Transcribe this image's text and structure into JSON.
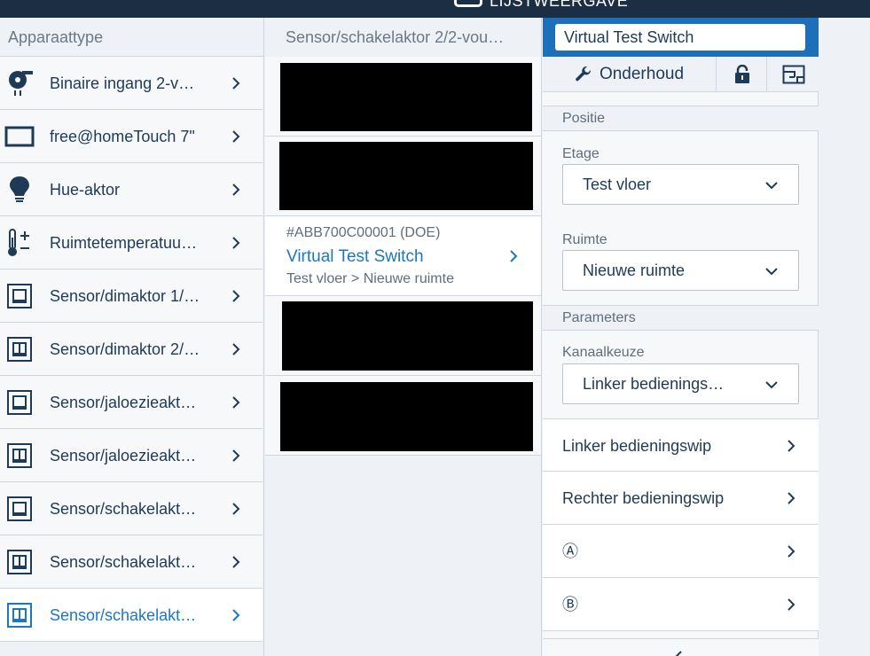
{
  "app": {
    "header_title": "LIJSTWEERGAVE"
  },
  "device_types": {
    "header": "Apparaattype",
    "items": [
      {
        "label": "Binaire ingang 2-v…",
        "icon": "binary-input-icon"
      },
      {
        "label": "free@homeTouch 7\"",
        "icon": "display-panel-icon"
      },
      {
        "label": "Hue-aktor",
        "icon": "bulb-icon"
      },
      {
        "label": "Ruimtetemperatuu…",
        "icon": "thermometer-icon"
      },
      {
        "label": "Sensor/dimaktor 1/…",
        "icon": "single-rocker-icon"
      },
      {
        "label": "Sensor/dimaktor 2/…",
        "icon": "double-rocker-icon"
      },
      {
        "label": "Sensor/jaloezieakt…",
        "icon": "single-rocker-icon"
      },
      {
        "label": "Sensor/jaloezieakt…",
        "icon": "double-rocker-icon"
      },
      {
        "label": "Sensor/schakelakt…",
        "icon": "single-rocker-icon"
      },
      {
        "label": "Sensor/schakelakt…",
        "icon": "double-rocker-icon"
      },
      {
        "label": "Sensor/schakelakt…",
        "icon": "double-rocker-icon"
      }
    ],
    "selected_index": 10
  },
  "channels": {
    "header": "Sensor/schakelaktor 2/2-vou…",
    "selected": {
      "id": "#ABB700C00001 (DOE)",
      "name": "Virtual Test Switch",
      "location": "Test vloer > Nieuwe ruimte"
    }
  },
  "details": {
    "name_value": "Virtual Test Switch",
    "toolbar": {
      "maintenance_label": "Onderhoud",
      "maintenance_icon": "wrench-icon",
      "lock_icon": "unlock-icon",
      "map_icon": "floorplan-icon"
    },
    "position_header": "Positie",
    "floor_label": "Etage",
    "floor_value": "Test vloer",
    "room_label": "Ruimte",
    "room_value": "Nieuwe ruimte",
    "parameters_header": "Parameters",
    "channel_choice_label": "Kanaalkeuze",
    "channel_choice_value": "Linker bedienings…",
    "rows": [
      {
        "label": "Linker bedieningswip"
      },
      {
        "label": "Rechter bedieningswip"
      },
      {
        "label": "Ⓐ"
      },
      {
        "label": "Ⓑ"
      }
    ]
  },
  "colors": {
    "accent": "#1c77c3",
    "header_bar": "#1c2e44",
    "name_bar": "#1c6fb8",
    "text": "#1f3a57"
  }
}
